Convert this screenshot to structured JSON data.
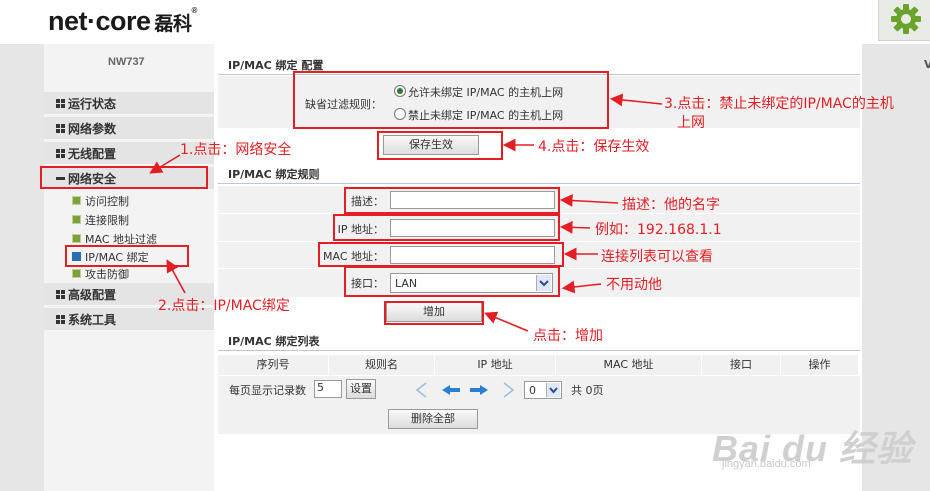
{
  "header": {
    "logo_text": "net·core",
    "logo_cn": "磊科",
    "logo_reg": "®",
    "settings_icon": "gear-icon"
  },
  "right_edge_text": "V",
  "sidebar": {
    "model": "NW737",
    "items": [
      {
        "label": "运行状态"
      },
      {
        "label": "网络参数"
      },
      {
        "label": "无线配置"
      },
      {
        "label": "网络安全"
      },
      {
        "label": "高级配置"
      },
      {
        "label": "系统工具"
      }
    ],
    "sub_items": [
      {
        "label": "访问控制"
      },
      {
        "label": "连接限制"
      },
      {
        "label": "MAC 地址过滤"
      },
      {
        "label": "IP/MAC 绑定"
      },
      {
        "label": "攻击防御"
      }
    ]
  },
  "config": {
    "title": "IP/MAC 绑定 配置",
    "filter_label": "缺省过滤规则：",
    "option_allow": "允许未绑定 IP/MAC 的主机上网",
    "option_deny": "禁止未绑定 IP/MAC 的主机上网",
    "selected": "allow",
    "save_label": "保存生效"
  },
  "rules": {
    "title": "IP/MAC 绑定规则",
    "desc_label": "描述：",
    "desc_value": "",
    "ip_label": "IP 地址：",
    "ip_value": "",
    "mac_label": "MAC 地址：",
    "mac_value": "",
    "port_label": "接口：",
    "port_value": "LAN",
    "add_label": "增加"
  },
  "list": {
    "title": "IP/MAC 绑定列表",
    "columns": [
      "序列号",
      "规则名",
      "IP 地址",
      "MAC 地址",
      "接口",
      "操作"
    ],
    "per_page_label": "每页显示记录数",
    "per_page_value": "5",
    "set_label": "设置",
    "page_value": "0",
    "total_label": "共 0页",
    "delete_all_label": "删除全部"
  },
  "annotations": {
    "a1": "1.点击：网络安全",
    "a2": "2.点击：IP/MAC绑定",
    "a3_line1": "3.点击：禁止未绑定的IP/MAC的主机",
    "a3_line2": "上网",
    "a4": "4.点击：保存生效",
    "desc": "描述：他的名字",
    "ip": "例如：192.168.1.1",
    "mac": "连接列表可以查看",
    "port": "不用动他",
    "add": "点击：增加",
    "color": "#e31e24"
  },
  "watermark": {
    "main": "Bai du 经验",
    "url": "jingyan.baidu.com"
  }
}
